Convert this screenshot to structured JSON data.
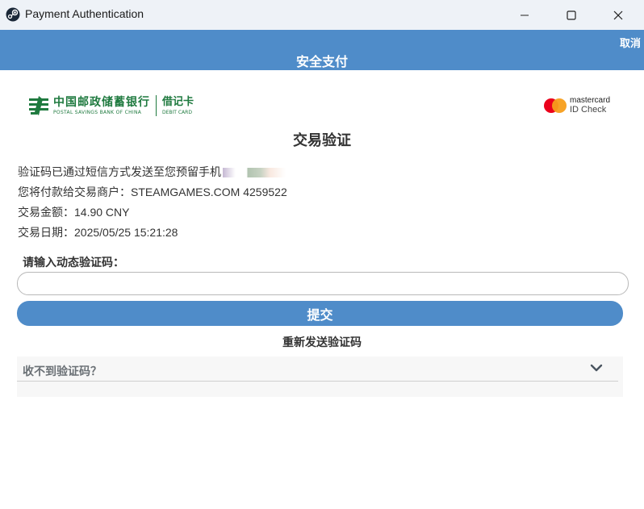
{
  "window": {
    "title": "Payment Authentication",
    "icon": "steam-icon",
    "controls": [
      "minimize-icon",
      "maximize-icon",
      "close-icon"
    ]
  },
  "header": {
    "title": "安全支付",
    "cancel_label": "取消",
    "background": "#4f8cc9"
  },
  "bank": {
    "name_cn": "中国邮政储蓄银行",
    "name_en": "POSTAL SAVINGS BANK OF CHINA",
    "card_type_cn": "借记卡",
    "card_type_en": "DEBIT CARD",
    "color": "#1f7a3f"
  },
  "scheme": {
    "brand": "mastercard",
    "sub": "ID Check"
  },
  "page": {
    "heading": "交易验证",
    "info": {
      "sms_notice": "验证码已通过短信方式发送至您预留手机",
      "merchant": "您将付款给交易商户：STEAMGAMES.COM 4259522",
      "amount": "交易金额：14.90 CNY",
      "date": "交易日期：2025/05/25 15:21:28"
    },
    "otp_label": "请输入动态验证码：",
    "otp_value": "",
    "otp_placeholder": "",
    "submit_label": "提交",
    "resend_label": "重新发送验证码",
    "faq_title": "收不到验证码？"
  }
}
